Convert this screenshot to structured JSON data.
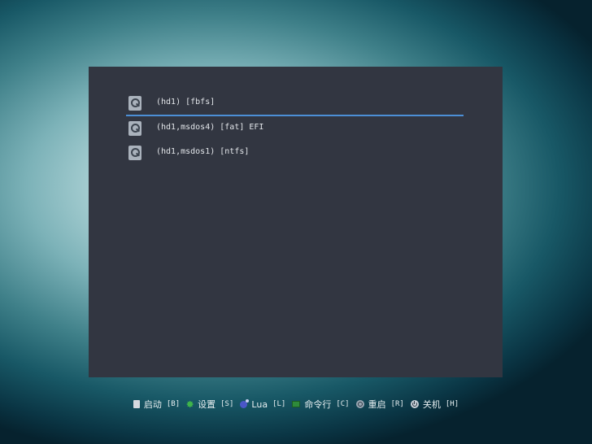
{
  "menu": {
    "items": [
      {
        "label": "(hd1) [fbfs]",
        "icon": "disk-icon",
        "selected": true
      },
      {
        "label": "(hd1,msdos4) [fat] EFI",
        "icon": "disk-icon",
        "selected": false
      },
      {
        "label": "(hd1,msdos1) [ntfs]",
        "icon": "disk-icon",
        "selected": false
      }
    ]
  },
  "footer": {
    "boot": {
      "label": "启动",
      "key": "[B]",
      "icon": "boot-icon"
    },
    "settings": {
      "label": "设置",
      "key": "[S]",
      "icon": "settings-gear-icon"
    },
    "lua": {
      "label": "Lua",
      "key": "[L]",
      "icon": "lua-icon"
    },
    "command_line": {
      "label": "命令行",
      "key": "[C]",
      "icon": "terminal-icon"
    },
    "reboot": {
      "label": "重启",
      "key": "[R]",
      "icon": "reboot-icon"
    },
    "shutdown": {
      "label": "关机",
      "key": "[H]",
      "icon": "power-icon"
    }
  },
  "colors": {
    "panel_background": "#323641",
    "selection_underline": "#4c8fd6",
    "text": "#e3e6ea"
  }
}
